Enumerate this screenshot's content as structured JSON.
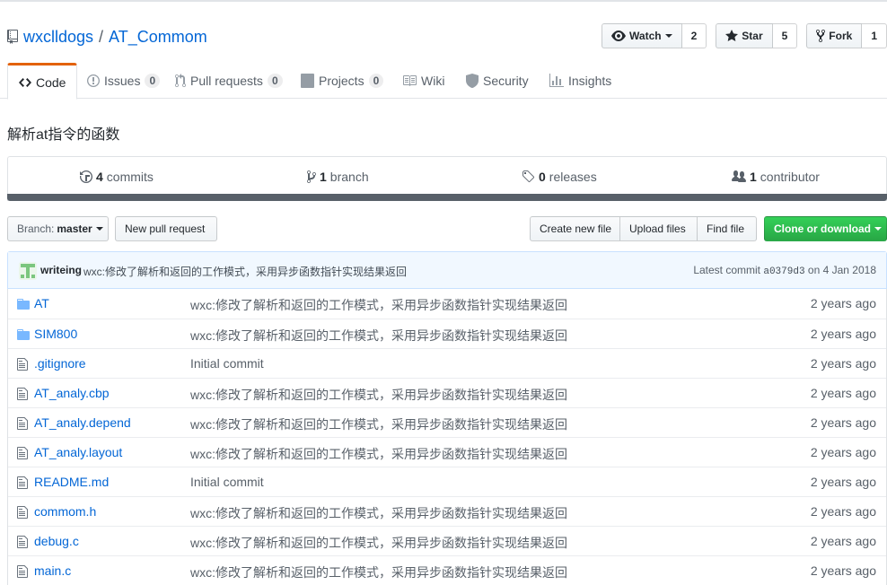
{
  "repo": {
    "owner": "wxclldogs",
    "separator": "/",
    "name": "AT_Commom",
    "description": "解析at指令的函数"
  },
  "social": {
    "watch_label": "Watch",
    "watch_count": "2",
    "star_label": "Star",
    "star_count": "5",
    "fork_label": "Fork",
    "fork_count": "1"
  },
  "nav": {
    "code": "Code",
    "issues": "Issues",
    "issues_count": "0",
    "pulls": "Pull requests",
    "pulls_count": "0",
    "projects": "Projects",
    "projects_count": "0",
    "wiki": "Wiki",
    "security": "Security",
    "insights": "Insights"
  },
  "summary": {
    "commits_num": "4",
    "commits_label": "commits",
    "branch_num": "1",
    "branch_label": "branch",
    "releases_num": "0",
    "releases_label": "releases",
    "contributor_num": "1",
    "contributor_label": "contributor"
  },
  "filenav": {
    "branch_label": "Branch:",
    "branch_name": "master",
    "new_pull_request": "New pull request",
    "create_new_file": "Create new file",
    "upload_files": "Upload files",
    "find_file": "Find file",
    "clone_or_download": "Clone or download"
  },
  "latest_commit": {
    "author": "writeing",
    "message": "wxc:修改了解析和返回的工作模式，采用异步函数指针实现结果返回",
    "prefix": "Latest commit",
    "sha": "a0379d3",
    "date": "on 4 Jan 2018"
  },
  "files": [
    {
      "type": "dir",
      "name": "AT",
      "message": "wxc:修改了解析和返回的工作模式，采用异步函数指针实现结果返回",
      "age": "2 years ago"
    },
    {
      "type": "dir",
      "name": "SIM800",
      "message": "wxc:修改了解析和返回的工作模式，采用异步函数指针实现结果返回",
      "age": "2 years ago"
    },
    {
      "type": "file",
      "name": ".gitignore",
      "message": "Initial commit",
      "age": "2 years ago"
    },
    {
      "type": "file",
      "name": "AT_analy.cbp",
      "message": "wxc:修改了解析和返回的工作模式，采用异步函数指针实现结果返回",
      "age": "2 years ago"
    },
    {
      "type": "file",
      "name": "AT_analy.depend",
      "message": "wxc:修改了解析和返回的工作模式，采用异步函数指针实现结果返回",
      "age": "2 years ago"
    },
    {
      "type": "file",
      "name": "AT_analy.layout",
      "message": "wxc:修改了解析和返回的工作模式，采用异步函数指针实现结果返回",
      "age": "2 years ago"
    },
    {
      "type": "file",
      "name": "README.md",
      "message": "Initial commit",
      "age": "2 years ago"
    },
    {
      "type": "file",
      "name": "commom.h",
      "message": "wxc:修改了解析和返回的工作模式，采用异步函数指针实现结果返回",
      "age": "2 years ago"
    },
    {
      "type": "file",
      "name": "debug.c",
      "message": "wxc:修改了解析和返回的工作模式，采用异步函数指针实现结果返回",
      "age": "2 years ago"
    },
    {
      "type": "file",
      "name": "main.c",
      "message": "wxc:修改了解析和返回的工作模式，采用异步函数指针实现结果返回",
      "age": "2 years ago"
    }
  ],
  "colors": {
    "link": "#0366d6",
    "tab_accent": "#e36209",
    "primary_button": "#28a745",
    "commit_bg": "#f1f8ff",
    "folder_icon": "#79b8ff"
  }
}
